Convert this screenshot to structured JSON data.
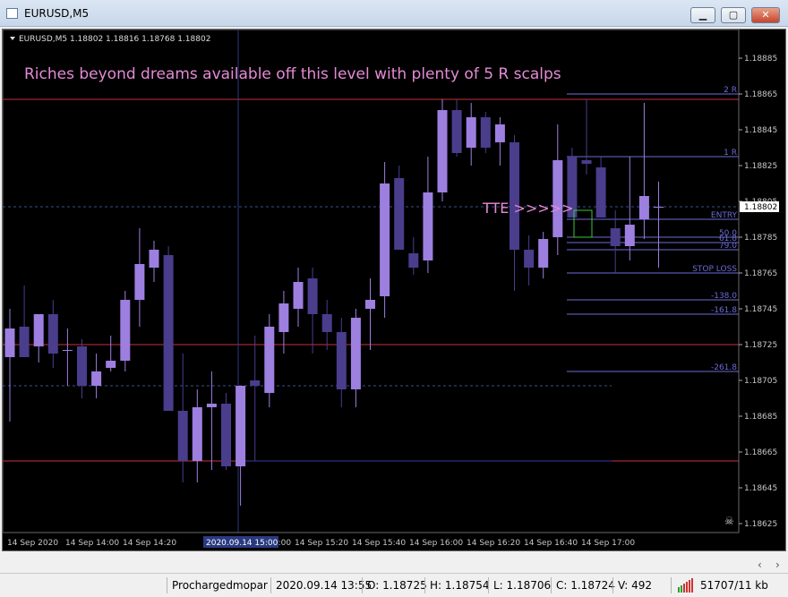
{
  "window": {
    "title": "EURUSD,M5",
    "minimize_label": "▁",
    "maximize_label": "▢",
    "close_label": "✕"
  },
  "chart_header": {
    "symbol_info": "EURUSD,M5",
    "ohlc": "1.18802 1.18816 1.18768 1.18802"
  },
  "annotations": {
    "headline": "Riches beyond dreams available off this level with plenty of 5  R scalps",
    "tte": "TTE >>>>>",
    "skull": "☠"
  },
  "fib_labels": [
    "2  R",
    "1  R",
    "ENTRY",
    "50.0",
    "61.8",
    "79.0",
    "STOP LOSS",
    "-138.0",
    "-161.8",
    "-261.8"
  ],
  "price_axis": [
    "1.18885",
    "1.18865",
    "1.18845",
    "1.18825",
    "1.18805",
    "1.18785",
    "1.18765",
    "1.18745",
    "1.18725",
    "1.18705",
    "1.18685",
    "1.18665",
    "1.18645",
    "1.18625"
  ],
  "current_price": "1.18802",
  "time_axis": [
    "14 Sep 2020",
    "14 Sep 14:00",
    "14 Sep 14:20",
    "14 Sep 15:00",
    "14 Sep 15:20",
    "14 Sep 15:40",
    "14 Sep 16:00",
    "14 Sep 16:20",
    "14 Sep 16:40",
    "14 Sep 17:00"
  ],
  "crosshair_time": "2020.09.14 15:00",
  "colors": {
    "background": "#000000",
    "bull_candle": "#9d7fe0",
    "bear_candle": "#4a3d8c",
    "level_line": "#c8323c",
    "fib_line": "#6b6bd6",
    "text_pink": "#e58ad6"
  },
  "chart_data": {
    "type": "candlestick",
    "symbol": "EURUSD",
    "timeframe": "M5",
    "ylim": [
      1.1862,
      1.18895
    ],
    "candles": [
      {
        "o": 1.18718,
        "h": 1.18745,
        "l": 1.18682,
        "c": 1.18734
      },
      {
        "o": 1.18735,
        "h": 1.18758,
        "l": 1.18722,
        "c": 1.18718
      },
      {
        "o": 1.18724,
        "h": 1.1874,
        "l": 1.18715,
        "c": 1.18742
      },
      {
        "o": 1.18742,
        "h": 1.1875,
        "l": 1.18712,
        "c": 1.1872
      },
      {
        "o": 1.18722,
        "h": 1.18734,
        "l": 1.18702,
        "c": 1.18722
      },
      {
        "o": 1.18724,
        "h": 1.18728,
        "l": 1.18695,
        "c": 1.18702
      },
      {
        "o": 1.18702,
        "h": 1.1872,
        "l": 1.18695,
        "c": 1.1871
      },
      {
        "o": 1.18712,
        "h": 1.1873,
        "l": 1.1871,
        "c": 1.18716
      },
      {
        "o": 1.18716,
        "h": 1.18755,
        "l": 1.1871,
        "c": 1.1875
      },
      {
        "o": 1.1875,
        "h": 1.1879,
        "l": 1.18735,
        "c": 1.1877
      },
      {
        "o": 1.18768,
        "h": 1.18783,
        "l": 1.1876,
        "c": 1.18778
      },
      {
        "o": 1.18775,
        "h": 1.1878,
        "l": 1.18702,
        "c": 1.18688
      },
      {
        "o": 1.18688,
        "h": 1.1872,
        "l": 1.18648,
        "c": 1.1866
      },
      {
        "o": 1.1866,
        "h": 1.187,
        "l": 1.18648,
        "c": 1.1869
      },
      {
        "o": 1.1869,
        "h": 1.1871,
        "l": 1.18655,
        "c": 1.18692
      },
      {
        "o": 1.18692,
        "h": 1.18698,
        "l": 1.18655,
        "c": 1.18657
      },
      {
        "o": 1.18657,
        "h": 1.18702,
        "l": 1.18635,
        "c": 1.18702
      },
      {
        "o": 1.18705,
        "h": 1.1873,
        "l": 1.1866,
        "c": 1.18702
      },
      {
        "o": 1.18698,
        "h": 1.18742,
        "l": 1.1869,
        "c": 1.18735
      },
      {
        "o": 1.18732,
        "h": 1.18755,
        "l": 1.1872,
        "c": 1.18748
      },
      {
        "o": 1.18745,
        "h": 1.18768,
        "l": 1.18735,
        "c": 1.1876
      },
      {
        "o": 1.18762,
        "h": 1.18768,
        "l": 1.1872,
        "c": 1.18742
      },
      {
        "o": 1.18742,
        "h": 1.1875,
        "l": 1.18722,
        "c": 1.18732
      },
      {
        "o": 1.18732,
        "h": 1.1874,
        "l": 1.1869,
        "c": 1.187
      },
      {
        "o": 1.187,
        "h": 1.18745,
        "l": 1.1869,
        "c": 1.1874
      },
      {
        "o": 1.18745,
        "h": 1.18762,
        "l": 1.18722,
        "c": 1.1875
      },
      {
        "o": 1.18752,
        "h": 1.18827,
        "l": 1.1874,
        "c": 1.18815
      },
      {
        "o": 1.18818,
        "h": 1.18825,
        "l": 1.18778,
        "c": 1.18778
      },
      {
        "o": 1.18776,
        "h": 1.18785,
        "l": 1.18764,
        "c": 1.18768
      },
      {
        "o": 1.18772,
        "h": 1.1883,
        "l": 1.18765,
        "c": 1.1881
      },
      {
        "o": 1.1881,
        "h": 1.18862,
        "l": 1.18805,
        "c": 1.18856
      },
      {
        "o": 1.18856,
        "h": 1.18862,
        "l": 1.1883,
        "c": 1.18832
      },
      {
        "o": 1.18835,
        "h": 1.1886,
        "l": 1.18825,
        "c": 1.18852
      },
      {
        "o": 1.18852,
        "h": 1.18855,
        "l": 1.18832,
        "c": 1.18835
      },
      {
        "o": 1.18838,
        "h": 1.18852,
        "l": 1.18825,
        "c": 1.18848
      },
      {
        "o": 1.18838,
        "h": 1.18842,
        "l": 1.18755,
        "c": 1.18778
      },
      {
        "o": 1.18778,
        "h": 1.18786,
        "l": 1.18758,
        "c": 1.18768
      },
      {
        "o": 1.18768,
        "h": 1.18788,
        "l": 1.18762,
        "c": 1.18784
      },
      {
        "o": 1.18785,
        "h": 1.18848,
        "l": 1.18775,
        "c": 1.18828
      },
      {
        "o": 1.1883,
        "h": 1.18835,
        "l": 1.18798,
        "c": 1.18796
      },
      {
        "o": 1.18828,
        "h": 1.18862,
        "l": 1.1882,
        "c": 1.18826
      },
      {
        "o": 1.18824,
        "h": 1.1883,
        "l": 1.18798,
        "c": 1.18796
      },
      {
        "o": 1.1879,
        "h": 1.188,
        "l": 1.18765,
        "c": 1.1878
      },
      {
        "o": 1.1878,
        "h": 1.1883,
        "l": 1.18772,
        "c": 1.18792
      },
      {
        "o": 1.18795,
        "h": 1.1886,
        "l": 1.18784,
        "c": 1.18808
      },
      {
        "o": 1.18802,
        "h": 1.18816,
        "l": 1.18768,
        "c": 1.18802
      }
    ]
  },
  "statusbar": {
    "profile": "Prochargedmopar",
    "datetime": "2020.09.14 13:55",
    "open": "O: 1.18725",
    "high": "H: 1.18754",
    "low": "L: 1.18706",
    "close": "C: 1.18724",
    "volume": "V: 492",
    "traffic": "51707/11 kb"
  }
}
